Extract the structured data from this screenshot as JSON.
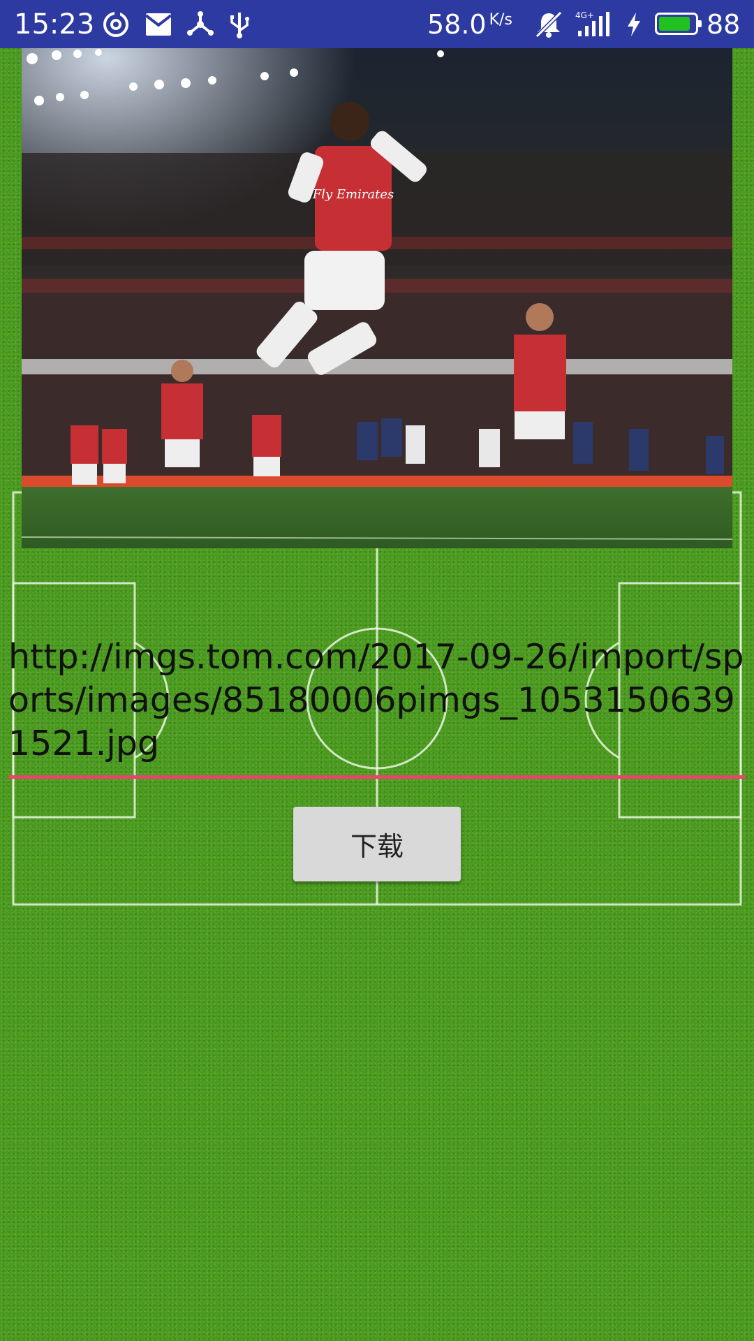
{
  "status_bar": {
    "time": "15:23",
    "net_speed": "58.0",
    "net_speed_unit": "K/s",
    "network_type": "4G+",
    "battery_percent": "88",
    "battery_level": 0.88,
    "icons": [
      "hotspot-sync-icon",
      "mail-icon",
      "share-icon",
      "usb-icon",
      "mute-icon",
      "signal-icon",
      "charging-icon",
      "battery-icon"
    ]
  },
  "image": {
    "jersey_text": "Fly Emirates"
  },
  "url_input": {
    "value": "http://imgs.tom.com/2017-09-26/import/sports/images/85180006pimgs_10531506391521.jpg"
  },
  "download_button": {
    "label": "下载"
  },
  "colors": {
    "status_bar": "#2d3aa2",
    "accent_underline": "#e8456d",
    "grass": "#4a9a1e",
    "button_bg": "#d9d9d9"
  }
}
